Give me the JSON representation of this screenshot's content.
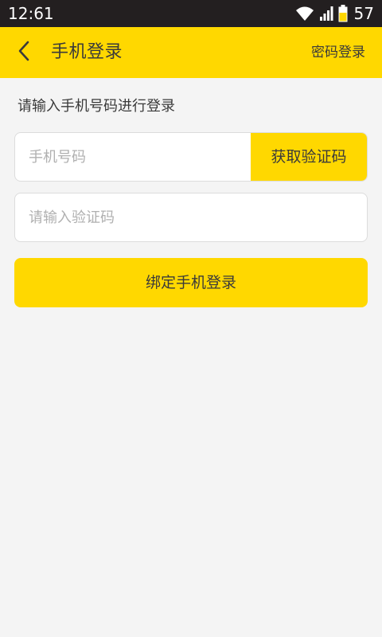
{
  "status_bar": {
    "time": "12:61",
    "battery": "57",
    "icons": [
      "wifi-icon",
      "cell-signal-icon",
      "battery-icon"
    ]
  },
  "header": {
    "back_icon": "chevron-left-icon",
    "title": "手机登录",
    "password_login": "密码登录"
  },
  "main": {
    "prompt": "请输入手机号码进行登录",
    "phone_placeholder": "手机号码",
    "phone_value": "",
    "get_code_label": "获取验证码",
    "code_placeholder": "请输入验证码",
    "code_value": "",
    "bind_login_label": "绑定手机登录"
  },
  "colors": {
    "accent": "#ffd800",
    "status_bar": "#231f20",
    "background": "#f4f4f4",
    "text": "#3a3a3a",
    "placeholder": "#b0b0b0"
  }
}
